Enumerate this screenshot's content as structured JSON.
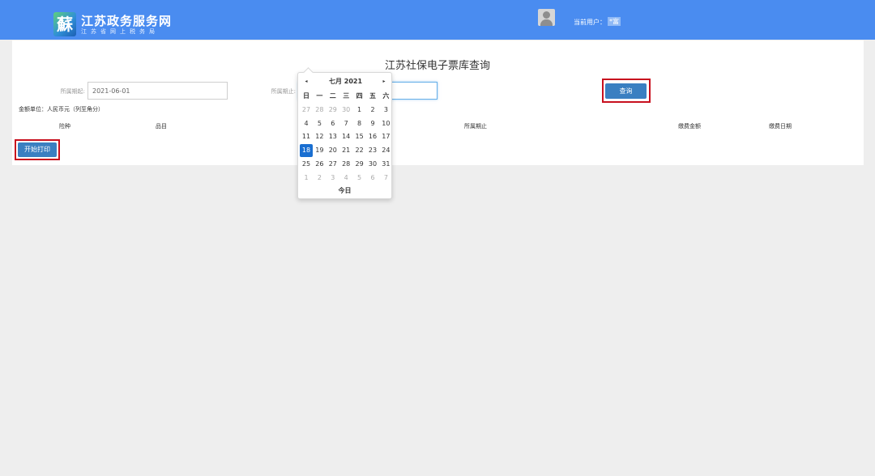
{
  "header": {
    "logo_glyph": "蘇",
    "site_title": "江苏政务服务网",
    "site_subtitle": "江苏省网上税务局",
    "user_label": "当前用户：",
    "user_value": "*富",
    "brand_color": "#4a8cf0"
  },
  "page": {
    "title": "江苏社保电子票库查询"
  },
  "form": {
    "start_label": "所属期起:",
    "start_value": "2021-06-01",
    "end_label": "所属期止:",
    "end_value": "",
    "query_button": "查询"
  },
  "unit": {
    "label": "金额单位：",
    "value": "人民币元（列至角分）"
  },
  "table": {
    "headers": [
      "险种",
      "品目",
      "所属期止",
      "缴费金额",
      "缴费日期"
    ]
  },
  "print_button": "开始打印",
  "datepicker": {
    "prev": "◂",
    "next": "▸",
    "title": "七月 2021",
    "weekdays": [
      "日",
      "一",
      "二",
      "三",
      "四",
      "五",
      "六"
    ],
    "weeks": [
      [
        "27",
        "28",
        "29",
        "30",
        "1",
        "2",
        "3"
      ],
      [
        "4",
        "5",
        "6",
        "7",
        "8",
        "9",
        "10"
      ],
      [
        "11",
        "12",
        "13",
        "14",
        "15",
        "16",
        "17"
      ],
      [
        "18",
        "19",
        "20",
        "21",
        "22",
        "23",
        "24"
      ],
      [
        "25",
        "26",
        "27",
        "28",
        "29",
        "30",
        "31"
      ],
      [
        "1",
        "2",
        "3",
        "4",
        "5",
        "6",
        "7"
      ]
    ],
    "selected_day": "18",
    "today_label": "今日"
  },
  "colors": {
    "button": "#3a7fc1",
    "highlight_frame": "#c8101e",
    "selected_day": "#1a6fd1"
  }
}
